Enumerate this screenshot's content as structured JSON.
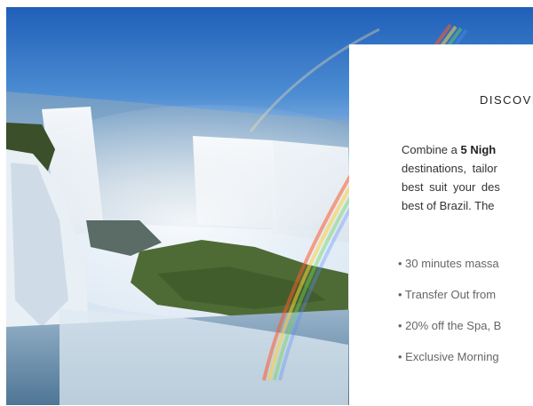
{
  "hero": {
    "image": "waterfall-rainbow-photo"
  },
  "card": {
    "eyebrow": "DISCOVER",
    "intro_before": "Combine a ",
    "intro_bold": "5 Nigh",
    "intro_lines": [
      "destinations, tailor",
      "best suit your des",
      "best of Brazil. The"
    ],
    "perks": [
      "• 30 minutes massa",
      "• Transfer Out from",
      "• 20% off the Spa, B",
      "• Exclusive Morning"
    ]
  },
  "colors": {
    "sky": "#2a6fc4",
    "mist": "#dfe9f3",
    "foliage": "#4f6b35",
    "text": "#333333",
    "muted": "#666666"
  }
}
